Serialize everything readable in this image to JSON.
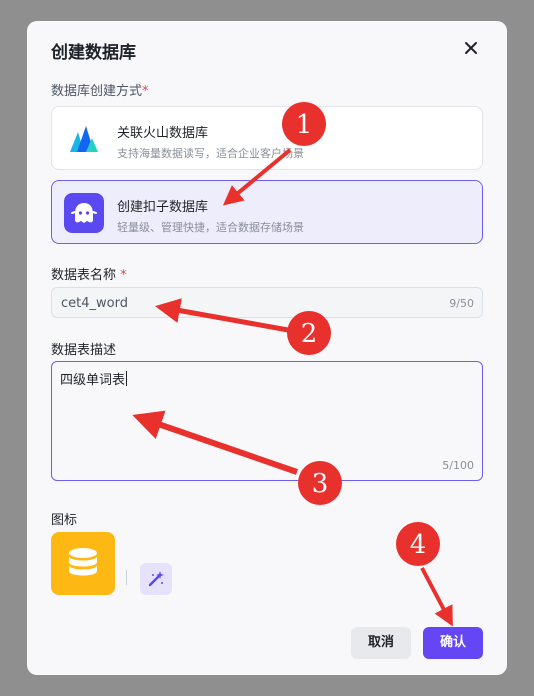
{
  "dialog": {
    "title": "创建数据库",
    "close_icon": "close-icon"
  },
  "method": {
    "label": "数据库创建方式",
    "required_mark": "*",
    "options": [
      {
        "title": "关联火山数据库",
        "desc": "支持海量数据读写，适合企业客户场景",
        "icon": "volcano-logo-icon",
        "selected": false
      },
      {
        "title": "创建扣子数据库",
        "desc": "轻量级、管理快捷，适合数据存储场景",
        "icon": "coze-logo-icon",
        "selected": true
      }
    ]
  },
  "table_name": {
    "label": "数据表名称",
    "required_mark": "*",
    "value": "cet4_word",
    "counter": "9/50"
  },
  "table_desc": {
    "label": "数据表描述",
    "value": "四级单词表",
    "counter": "5/100"
  },
  "icon_section": {
    "label": "图标",
    "icon": "database-icon",
    "generate_icon": "magic-wand-icon"
  },
  "buttons": {
    "cancel": "取消",
    "confirm": "确认"
  },
  "annotations": {
    "badges": [
      "1",
      "2",
      "3",
      "4"
    ],
    "color": "#e8302c"
  },
  "colors": {
    "accent": "#6446f5",
    "selected_bg": "#eeedfb",
    "icon_bg": "#fdb813",
    "overlay": "#8f8f8f"
  }
}
